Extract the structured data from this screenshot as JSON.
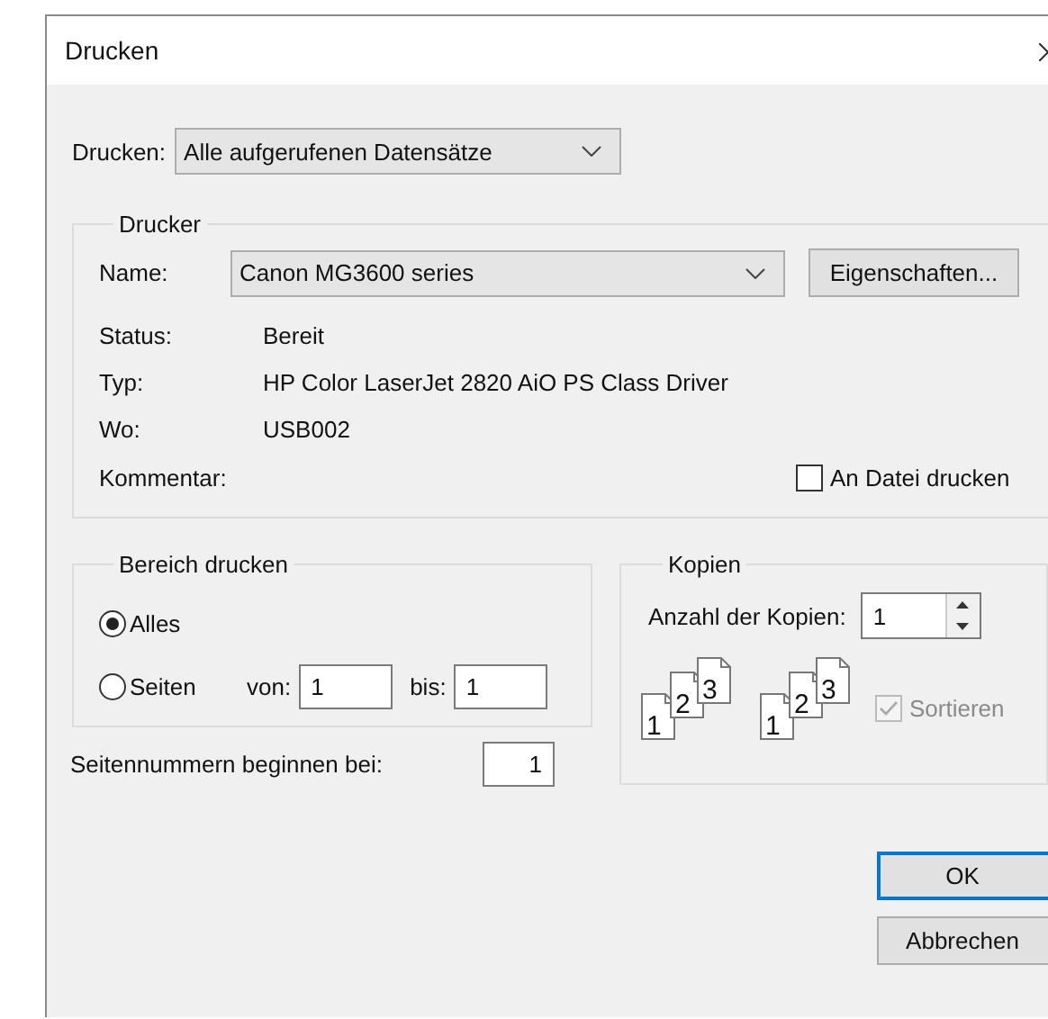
{
  "window": {
    "title": "Drucken"
  },
  "print_what": {
    "label": "Drucken:",
    "value": "Alle aufgerufenen Datensätze"
  },
  "printer": {
    "legend": "Drucker",
    "name_label": "Name:",
    "name_value": "Canon MG3600 series",
    "properties_button": "Eigenschaften...",
    "info": [
      {
        "label": "Status:",
        "value": "Bereit"
      },
      {
        "label": "Typ:",
        "value": "HP Color LaserJet 2820 AiO PS Class Driver"
      },
      {
        "label": "Wo:",
        "value": "USB002"
      },
      {
        "label": "Kommentar:"
      }
    ],
    "print_to_file": {
      "label": "An Datei drucken",
      "checked": false
    }
  },
  "range": {
    "legend": "Bereich drucken",
    "options": [
      {
        "label": "Alles",
        "selected": true
      },
      {
        "label": "Seiten",
        "selected": false
      }
    ],
    "from_label": "von:",
    "from_value": "1",
    "to_label": "bis:",
    "to_value": "1"
  },
  "start_page": {
    "label": "Seitennummern beginnen bei:",
    "value": "1"
  },
  "copies": {
    "legend": "Kopien",
    "count_label": "Anzahl der Kopien:",
    "count_value": "1",
    "collate_icons": [
      {
        "pages": [
          "1",
          "2",
          "3"
        ]
      },
      {
        "pages": [
          "1",
          "2",
          "3"
        ]
      }
    ],
    "collate": {
      "label": "Sortieren",
      "checked": true,
      "disabled": true
    }
  },
  "buttons": [
    {
      "label": "OK",
      "default": true
    },
    {
      "label": "Abbrechen",
      "default": false
    }
  ]
}
